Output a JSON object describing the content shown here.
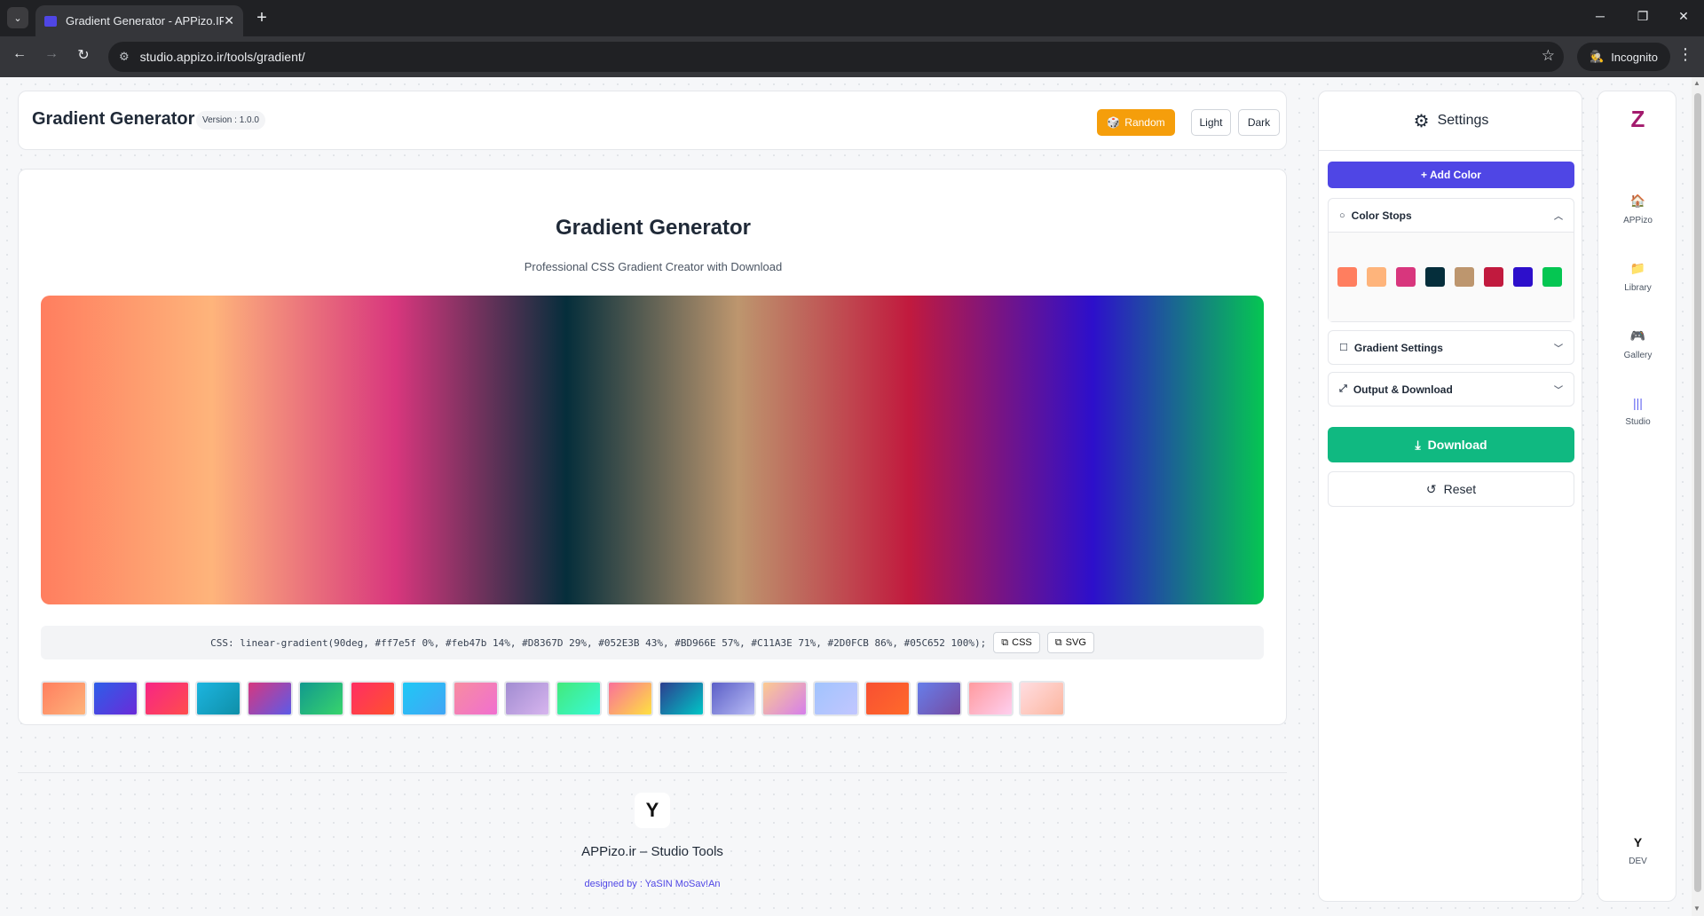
{
  "browser": {
    "tab_menu_icon": "chevron-down-icon",
    "tab_title": "Gradient Generator - APPizo.IR",
    "tab_close": "✕",
    "new_tab": "+",
    "url": "studio.appizo.ir/tools/gradient/",
    "incognito_label": "Incognito",
    "win_min": "─",
    "win_restore": "❐",
    "win_close": "✕",
    "back": "←",
    "forward": "→",
    "reload": "↻",
    "star": "☆",
    "kebab": "⋮",
    "site_icon": "⚙",
    "incognito_icon": "🕵"
  },
  "header": {
    "title": "Gradient Generator",
    "version": "Version : 1.0.0",
    "random_label": "Random",
    "random_icon": "🎲",
    "light_label": "Light",
    "dark_label": "Dark"
  },
  "main": {
    "title": "Gradient Generator",
    "subtitle": "Professional CSS Gradient Creator with Download",
    "css_text": "CSS: linear-gradient(90deg, #ff7e5f 0%, #feb47b 14%, #D8367D 29%, #052E3B 43%, #BD966E 57%, #C11A3E 71%, #2D0FCB 86%, #05C652 100%);",
    "css_button": "CSS",
    "svg_button": "SVG",
    "copy_icon": "⧉"
  },
  "gradient": {
    "angle": 90,
    "stops": [
      {
        "color": "#ff7e5f",
        "pos": 0
      },
      {
        "color": "#feb47b",
        "pos": 14
      },
      {
        "color": "#D8367D",
        "pos": 29
      },
      {
        "color": "#052E3B",
        "pos": 43
      },
      {
        "color": "#BD966E",
        "pos": 57
      },
      {
        "color": "#C11A3E",
        "pos": 71
      },
      {
        "color": "#2D0FCB",
        "pos": 86
      },
      {
        "color": "#05C652",
        "pos": 100
      }
    ]
  },
  "presets": [
    [
      "#ff7e5f",
      "#feb47b"
    ],
    [
      "#2d5ee8",
      "#6a2bd9"
    ],
    [
      "#f72585",
      "#ff4d4d"
    ],
    [
      "#1cb5e0",
      "#0f8fa8"
    ],
    [
      "#d6377f",
      "#5c5be8"
    ],
    [
      "#11998e",
      "#38d46c"
    ],
    [
      "#ff2e63",
      "#ff512f"
    ],
    [
      "#1fc8f5",
      "#42a5f5"
    ],
    [
      "#f78ca0",
      "#f06fd0"
    ],
    [
      "#a18cd1",
      "#d7b5ee"
    ],
    [
      "#43e97b",
      "#38f9d7"
    ],
    [
      "#fa709a",
      "#fee140"
    ],
    [
      "#2c3e8f",
      "#00c6c6"
    ],
    [
      "#5b5fc7",
      "#b9bcf5"
    ],
    [
      "#fccb90",
      "#d57eeb"
    ],
    [
      "#a1c4fd",
      "#c2c6ff"
    ],
    [
      "#f85032",
      "#ff6a2b"
    ],
    [
      "#667eea",
      "#764ba2"
    ],
    [
      "#ff9a9e",
      "#fecfef"
    ],
    [
      "#ffdde1",
      "#fcb69f"
    ]
  ],
  "footer": {
    "logo": "Y",
    "name": "APPizo.ir – Studio Tools",
    "credit": "designed by : YaSIN MoSav!An"
  },
  "settings": {
    "title": "Settings",
    "gear_icon": "⚙",
    "add_color": "+ Add Color",
    "color_stops_label": "Color Stops",
    "color_stops_icon": "○",
    "chev_up": "︿",
    "gradient_settings_label": "Gradient Settings",
    "gradient_settings_icon": "☐",
    "output_label": "Output & Download",
    "output_icon": "⤢",
    "chev_down": "﹀",
    "download_label": "Download",
    "download_icon": "⤓",
    "reset_label": "Reset",
    "reset_icon": "↺"
  },
  "rail": {
    "logo": "Z",
    "logo_color": "#a31b6d",
    "items": [
      {
        "label": "APPizo",
        "icon": "🏠",
        "color": "#f97316"
      },
      {
        "label": "Library",
        "icon": "📁",
        "color": "#3b82f6"
      },
      {
        "label": "Gallery",
        "icon": "🎮",
        "color": "#6366f1"
      },
      {
        "label": "Studio",
        "icon": "|||",
        "color": "#6366f1"
      }
    ],
    "dev_logo": "Y",
    "dev_label": "DEV"
  }
}
